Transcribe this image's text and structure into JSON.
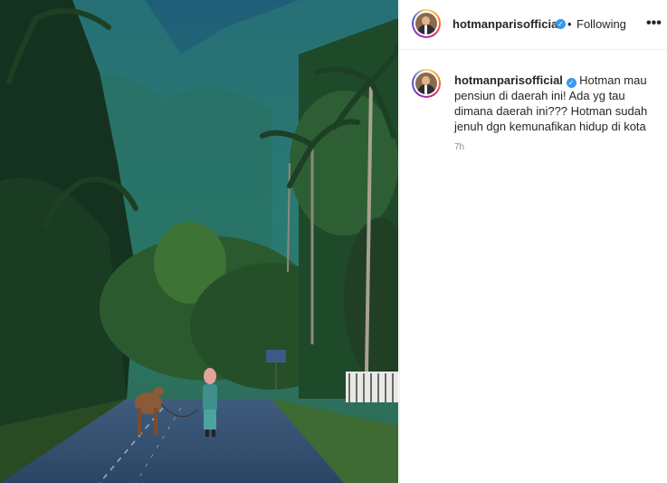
{
  "post": {
    "username": "hotmanparisofficial",
    "verified": true,
    "follow_state": "Following",
    "separator": "•",
    "more_label": "•••",
    "caption": "Hotman mau pensiun di daerah ini! Ada yg tau dimana daerah ini??? Hotman sudah jenuh dgn kemunafikan hidup di kota",
    "time": "7h"
  },
  "colors": {
    "verified": "#3897f0",
    "text": "#262626",
    "muted": "#8e8e8e"
  },
  "icons": {
    "verified": "verified-badge-icon",
    "more": "more-options-icon"
  }
}
